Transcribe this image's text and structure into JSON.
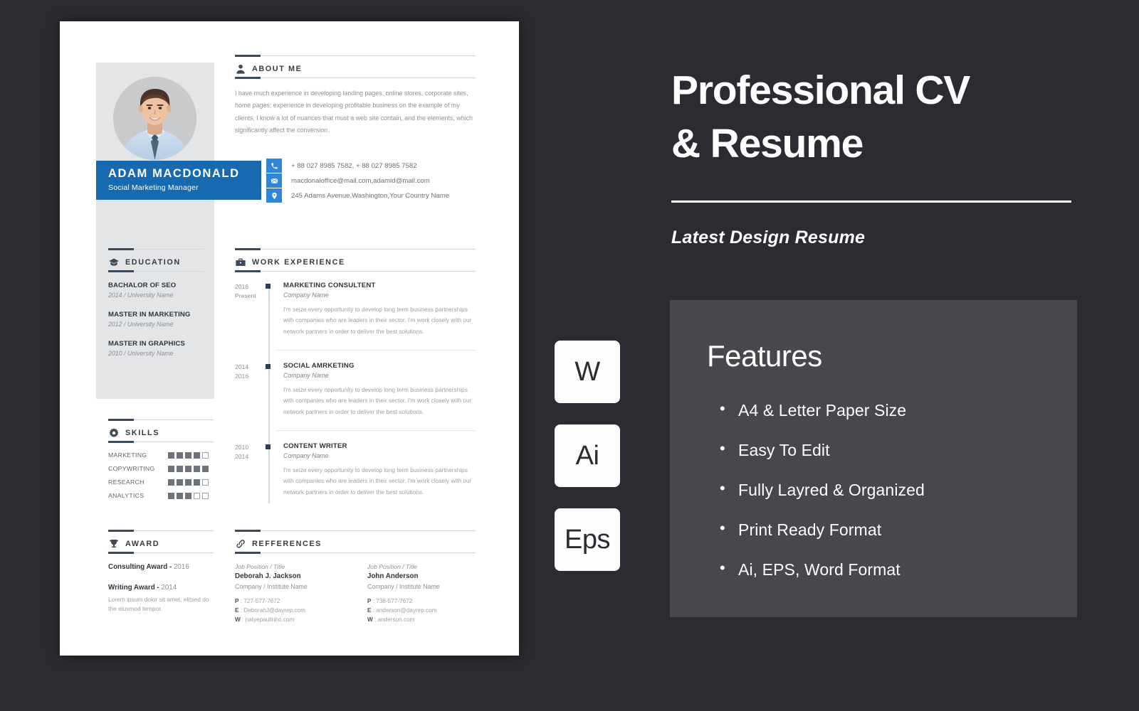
{
  "theme": {
    "background": "#2b2c31",
    "accent_blue": "#1769b0",
    "icon_blue": "#2f86d4",
    "dark_slate": "#3c4a5a",
    "feature_panel": "#47484c"
  },
  "resume": {
    "profile": {
      "name": "ADAM MACDONALD",
      "role": "Social Marketing Manager",
      "photo_alt": "profile-photo"
    },
    "contact": [
      {
        "icon": "phone-icon",
        "value": "+ 88 027 8985 7582, + 88 027 8985 7582"
      },
      {
        "icon": "envelope-icon",
        "value": "macdonaloffice@mail.com,adamid@mail.com"
      },
      {
        "icon": "location-pin-icon",
        "value": "245 Adams Avenue,Washington,Your Country Name"
      }
    ],
    "about": {
      "title": "ABOUT ME",
      "icon": "user-icon",
      "text": "I have much experience in developing landing pages, online stores, corporate sites, home pages; experience in developing profitable business on the example of my clients, I know a lot of nuances that must a web site contain, and the elements, which significantly affect the conversion."
    },
    "education": {
      "title": "EDUCATION",
      "icon": "graduation-cap-icon",
      "items": [
        {
          "degree": "BACHALOR OF SEO",
          "detail": "2014 / University Name"
        },
        {
          "degree": "MASTER IN MARKETING",
          "detail": "2012 / University Name"
        },
        {
          "degree": "MASTER IN GRAPHICS",
          "detail": "2010 / University Name"
        }
      ]
    },
    "work": {
      "title": "WORK EXPERIENCE",
      "icon": "briefcase-icon",
      "items": [
        {
          "year_start": "2016",
          "year_end": "Present",
          "job_title": "MARKETING CONSULTENT",
          "company": "Company Name",
          "description": "I'm seize every opportunity to develop long term business partnerships with companies who are leaders in their sector. I'm work closely with our network partners in order to deliver the best solutions."
        },
        {
          "year_start": "2014",
          "year_end": "2016",
          "job_title": "SOCIAL AMRKETING",
          "company": "Company Name",
          "description": "I'm seize every opportunity to develop long term business partnerships with companies who are leaders in their sector. I'm work closely with our network partners in order to deliver the best solutions."
        },
        {
          "year_start": "2010",
          "year_end": "2014",
          "job_title": "CONTENT WRITER",
          "company": "Company Name",
          "description": "I'm seize every opportunity to develop long term business partnerships with companies who are leaders in their sector. I'm work closely with our network partners in order to deliver the best solutions."
        }
      ]
    },
    "skills": {
      "title": "SKILLS",
      "icon": "gear-icon",
      "max": 5,
      "items": [
        {
          "name": "MARKETING",
          "level": 4
        },
        {
          "name": "COPYWRITING",
          "level": 5
        },
        {
          "name": "RESEARCH",
          "level": 4
        },
        {
          "name": "ANALYTICS",
          "level": 3
        }
      ]
    },
    "award": {
      "title": "AWARD",
      "icon": "trophy-icon",
      "items": [
        {
          "name": "Consulting Award - ",
          "year": "2016",
          "desc": ""
        },
        {
          "name": "Writing Award - ",
          "year": "2014",
          "desc": "Lorem ipsum dolor sit amet, elitsed do the eiusmod tempor."
        }
      ]
    },
    "references": {
      "title": "REFFERENCES",
      "icon": "link-icon",
      "items": [
        {
          "position": "Job Position / Title",
          "name": "Deborah J. Jackson",
          "company": "Company / Institute Name",
          "phone_label": "P",
          "phone": "727-577-7672",
          "email_label": "E",
          "email": "DeborahJ@dayrep.com",
          "web_label": "W",
          "web": "natyepaulinho.com"
        },
        {
          "position": "Job Position / Title",
          "name": "John Anderson",
          "company": "Company / Institute Name",
          "phone_label": "P",
          "phone": "738-577-7672",
          "email_label": "E",
          "email": "anderson@dayrep.com",
          "web_label": "W",
          "web": "anderson.com"
        }
      ]
    }
  },
  "promo": {
    "title_line1": "Professional CV",
    "title_line2": "& Resume",
    "subtitle": "Latest Design Resume",
    "features_heading": "Features",
    "features": [
      "A4 & Letter Paper Size",
      "Easy To Edit",
      "Fully Layred & Organized",
      "Print Ready Format",
      "Ai, EPS, Word Format"
    ],
    "format_badges": [
      {
        "label": "W",
        "name": "word-format-badge"
      },
      {
        "label": "Ai",
        "name": "illustrator-format-badge"
      },
      {
        "label": "Eps",
        "name": "eps-format-badge"
      }
    ]
  }
}
